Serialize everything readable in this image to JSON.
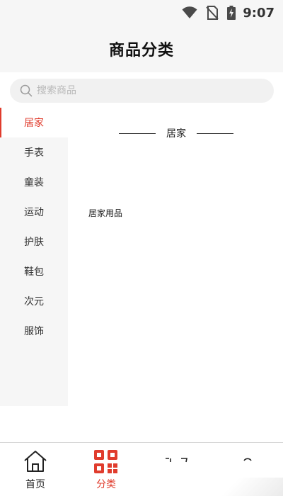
{
  "status_bar": {
    "time": "9:07",
    "icons": [
      "wifi-icon",
      "no-sim-icon",
      "battery-charging-icon"
    ]
  },
  "header": {
    "title": "商品分类"
  },
  "search": {
    "placeholder": "搜索商品",
    "value": "",
    "icon": "search-icon"
  },
  "sidebar": {
    "items": [
      {
        "label": "居家",
        "active": true
      },
      {
        "label": "手表",
        "active": false
      },
      {
        "label": "童装",
        "active": false
      },
      {
        "label": "运动",
        "active": false
      },
      {
        "label": "护肤",
        "active": false
      },
      {
        "label": "鞋包",
        "active": false
      },
      {
        "label": "次元",
        "active": false
      },
      {
        "label": "服饰",
        "active": false
      }
    ]
  },
  "content": {
    "section_title": "居家",
    "subcategories": [
      {
        "label": "居家用品"
      }
    ]
  },
  "tab_bar": {
    "tabs": [
      {
        "label": "首页",
        "icon": "home-icon",
        "active": false
      },
      {
        "label": "分类",
        "icon": "qr-grid-icon",
        "active": true
      },
      {
        "label": "",
        "icon": "cart-icon",
        "active": false
      },
      {
        "label": "",
        "icon": "user-icon",
        "active": false
      }
    ]
  },
  "colors": {
    "accent": "#e03c2d",
    "header_bg": "#f6f6f6",
    "sidebar_bg": "#f6f6f6",
    "search_bg": "#f1f1f1",
    "text": "#222222",
    "placeholder": "#b8b8b8"
  }
}
